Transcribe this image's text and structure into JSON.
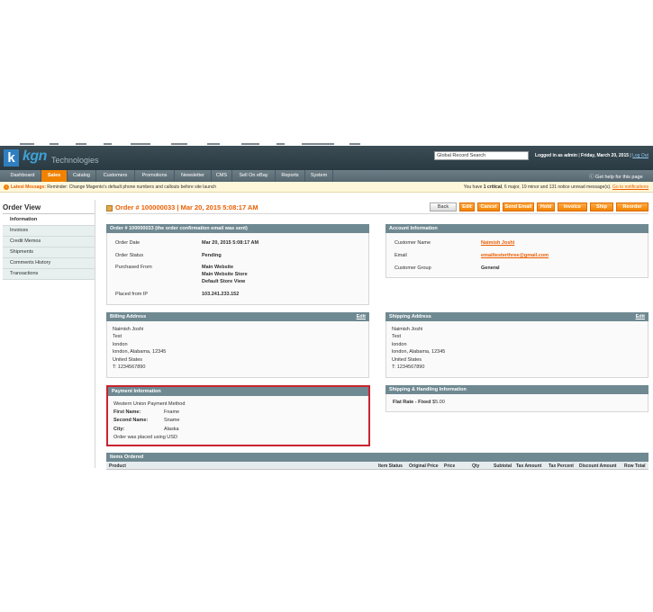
{
  "header": {
    "logo_mark": "k",
    "logo_text": "kgn",
    "logo_subtext": "Technologies",
    "search_value": "Global Record Search",
    "logged_in": "Logged in as admin",
    "date": "Friday, March 20, 2015",
    "logout": "Log Out"
  },
  "nav": {
    "items": [
      "Dashboard",
      "Sales",
      "Catalog",
      "Customers",
      "Promotions",
      "Newsletter",
      "CMS",
      "Sell On eBay",
      "Reports",
      "System"
    ],
    "help": "Get help for this page"
  },
  "message": {
    "label": "Latest Message:",
    "text": "Reminder: Change Magento's default phone numbers and callouts before site launch",
    "right_prefix": "You have",
    "critical": "1 critical",
    "major": "6 major",
    "minor": "19 minor",
    "notice": "131 notice unread message(s).",
    "link": "Go to notifications"
  },
  "sidebar": {
    "title": "Order View",
    "items": [
      "Information",
      "Invoices",
      "Credit Memos",
      "Shipments",
      "Comments History",
      "Transactions"
    ]
  },
  "order": {
    "title": "Order # 100000033 | Mar 20, 2015 5:08:17 AM",
    "buttons": [
      "Back",
      "Edit",
      "Cancel",
      "Send Email",
      "Hold",
      "Invoice",
      "Ship",
      "Reorder"
    ],
    "info_head": "Order # 100000033 (the order confirmation email was sent)",
    "date_label": "Order Date",
    "date_value": "Mar 20, 2015 5:08:17 AM",
    "status_label": "Order Status",
    "status_value": "Pending",
    "purchased_label": "Purchased From",
    "purchased_1": "Main Website",
    "purchased_2": "Main Website Store",
    "purchased_3": "Default Store View",
    "ip_label": "Placed from IP",
    "ip_value": "103.241.233.152"
  },
  "account": {
    "head": "Account Information",
    "name_label": "Customer Name",
    "name_value": "Naimish Joshi",
    "email_label": "Email",
    "email_value": "emailtesterthree@gmail.com",
    "group_label": "Customer Group",
    "group_value": "General"
  },
  "billing": {
    "head": "Billing Address",
    "edit": "Edit",
    "lines": [
      "Naimish Joshi",
      "Test",
      "london",
      "london, Alabama, 12345",
      "United States",
      "T: 1234567890"
    ]
  },
  "shipping": {
    "head": "Shipping Address",
    "edit": "Edit",
    "lines": [
      "Naimish Joshi",
      "Test",
      "london",
      "london, Alabama, 12345",
      "United States",
      "T: 1234567890"
    ]
  },
  "payment": {
    "head": "Payment Information",
    "method": "Western Union Payment Method",
    "first_label": "First Name:",
    "first_value": "Fname",
    "second_label": "Second Name:",
    "second_value": "Sname",
    "city_label": "City:",
    "city_value": "Alaska",
    "currency": "Order was placed using USD"
  },
  "shipping_handling": {
    "head": "Shipping & Handling Information",
    "rate_label": "Flat Rate - Fixed",
    "rate_value": "$5.00"
  },
  "items": {
    "head": "Items Ordered",
    "columns": [
      "Product",
      "Item Status",
      "Original Price",
      "Price",
      "Qty",
      "Subtotal",
      "Tax Amount",
      "Tax Percent",
      "Discount Amount",
      "Row Total"
    ]
  },
  "colors": {
    "accent": "#f18200",
    "header": "#2f3f47",
    "box_head": "#6f8992",
    "highlight": "#c9232f"
  }
}
